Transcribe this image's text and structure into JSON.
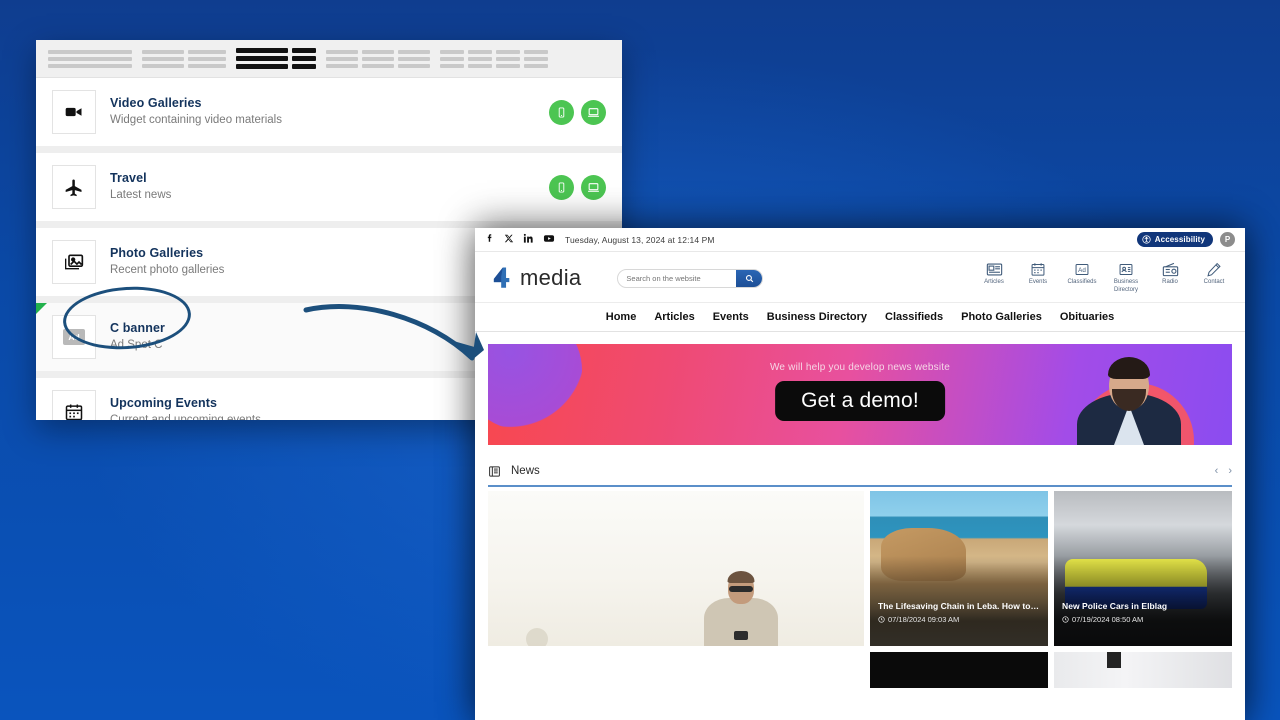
{
  "admin": {
    "topbar_skeleton_groups": 5,
    "active_group_index": 2,
    "widgets": [
      {
        "title": "Video Galleries",
        "subtitle": "Widget containing video materials",
        "icon": "video-camera-icon",
        "badges": [
          "mobile-icon",
          "desktop-icon"
        ],
        "selected": false,
        "flag": false
      },
      {
        "title": "Travel",
        "subtitle": "Latest news",
        "icon": "airplane-icon",
        "badges": [
          "mobile-icon",
          "desktop-icon"
        ],
        "selected": false,
        "flag": false
      },
      {
        "title": "Photo Galleries",
        "subtitle": "Recent photo galleries",
        "icon": "photo-icon",
        "badges": [],
        "selected": false,
        "flag": false
      },
      {
        "title": "C banner",
        "subtitle": "Ad Spot C",
        "icon": "ad-chip-icon",
        "badges": [],
        "selected": true,
        "flag": true
      },
      {
        "title": "Upcoming Events",
        "subtitle": "Current and upcoming events",
        "icon": "calendar-icon",
        "badges": [],
        "selected": false,
        "flag": false
      }
    ]
  },
  "site": {
    "utilbar": {
      "social": [
        "facebook-icon",
        "x-twitter-icon",
        "linkedin-icon",
        "youtube-icon"
      ],
      "date": "Tuesday, August 13, 2024 at 12:14 PM",
      "accessibility_label": "Accessibility",
      "avatar_initial": "P"
    },
    "brand": {
      "name": "media",
      "mark": "four-logo-icon"
    },
    "search": {
      "placeholder": "Search on the website",
      "value": "",
      "button_icon": "search-icon"
    },
    "quicklinks": [
      {
        "label": "Articles",
        "icon": "newspaper-icon"
      },
      {
        "label": "Events",
        "icon": "calendar-icon"
      },
      {
        "label": "Classifieds",
        "icon": "ad-icon"
      },
      {
        "label": "Business Directory",
        "icon": "contact-card-icon"
      },
      {
        "label": "Radio",
        "icon": "radio-icon"
      },
      {
        "label": "Contact",
        "icon": "pencil-icon"
      }
    ],
    "nav": [
      "Home",
      "Articles",
      "Events",
      "Business Directory",
      "Classifieds",
      "Photo Galleries",
      "Obituaries"
    ],
    "hero_ad": {
      "tagline": "We will help you develop news website",
      "cta": "Get a demo!",
      "colors": {
        "pink": "#ef4a72",
        "purple": "#8b4cf0",
        "red": "#f8484e",
        "cta_bg": "#0b0b0b"
      }
    },
    "news_section": {
      "title": "News",
      "icon": "news-icon",
      "prev": "‹",
      "next": "›",
      "cards": [
        {
          "title": "The Lifesaving Chain in Leba. How to…",
          "date": "07/18/2024 09:03 AM",
          "image": "beach-photo"
        },
        {
          "title": "New Police Cars in Elblag",
          "date": "07/19/2024 08:50 AM",
          "image": "police-car-photo"
        }
      ]
    }
  },
  "annotations": {
    "highlight_shape": "ellipse-around-c-banner",
    "arrow": "curved-arrow-pointing-to-site-banner",
    "color": "#1c4f7c"
  }
}
